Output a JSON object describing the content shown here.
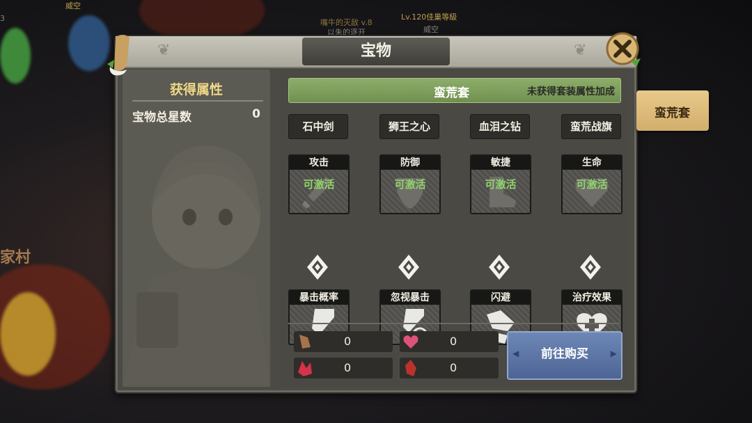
{
  "background": {
    "top_left_text": "威空",
    "top_left_sub": "3",
    "left_edge_text": "家村",
    "npc_title": "Lv.120佳巢等級",
    "npc_name": "威空",
    "player_title": "嘴牛的灭敌 v.8",
    "player_name": "以朱的逐开"
  },
  "dialog": {
    "title": "宝物",
    "close_icon": "close-x-icon"
  },
  "left_panel": {
    "title": "获得属性",
    "stat_label": "宝物总星数",
    "stat_value": "0"
  },
  "set_bar": {
    "name": "蛮荒套",
    "status": "未获得套装属性加成"
  },
  "treasures": [
    {
      "name": "石中剑",
      "stat": "攻击",
      "status": "可激活",
      "bonus": "暴击概率",
      "icon": "sword-icon"
    },
    {
      "name": "狮王之心",
      "stat": "防御",
      "status": "可激活",
      "bonus": "忽视暴击",
      "icon": "shield-icon"
    },
    {
      "name": "血泪之钻",
      "stat": "敏捷",
      "status": "可激活",
      "bonus": "闪避",
      "icon": "boot-icon"
    },
    {
      "name": "蛮荒战旗",
      "stat": "生命",
      "status": "可激活",
      "bonus": "治疗效果",
      "icon": "heart-icon"
    }
  ],
  "resources": [
    {
      "icon": "brown-crystal-icon",
      "value": "0"
    },
    {
      "icon": "pink-heart-gem-icon",
      "value": "0"
    },
    {
      "icon": "red-crystal-cluster-icon",
      "value": "0"
    },
    {
      "icon": "red-shard-icon",
      "value": "0"
    }
  ],
  "buy_button": "前往购买",
  "side_tab": "蛮荒套",
  "colors": {
    "active_green": "#8fd26a",
    "set_bar": "#7f9f5d",
    "buy_blue": "#5d76a6",
    "gold_title": "#f0d888"
  }
}
